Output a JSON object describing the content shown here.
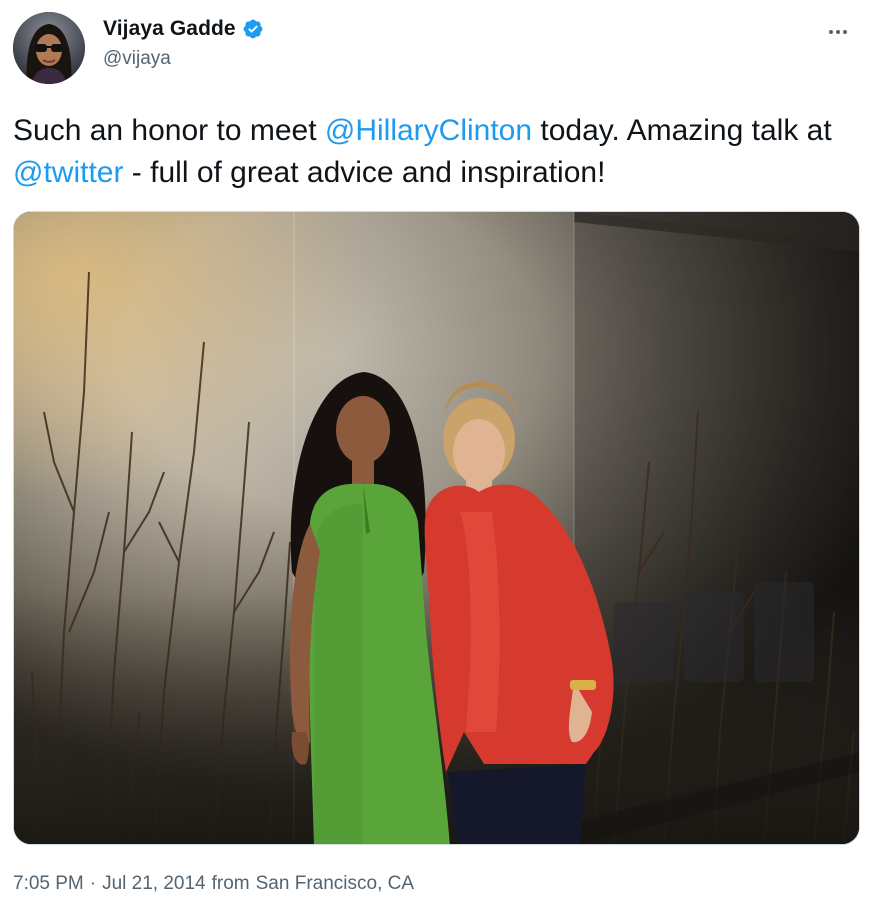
{
  "author": {
    "display_name": "Vijaya Gadde",
    "handle": "@vijaya",
    "verified": true,
    "avatar_icon": "profile-photo"
  },
  "menu": {
    "icon": "more-horizontal-icon"
  },
  "tweet": {
    "text_part_1": "Such an honor to meet ",
    "mention_1": "@HillaryClinton",
    "text_part_2": " today. Amazing talk at ",
    "mention_2": "@twitter",
    "text_part_3": " - full of great advice and inspiration!"
  },
  "media": {
    "type": "photo"
  },
  "meta": {
    "time": "7:05 PM",
    "separator": "·",
    "date": "Jul 21, 2014",
    "location_prefix": "from",
    "location": "San Francisco, CA"
  },
  "colors": {
    "link": "#1d9bf0",
    "text": "#0f1419",
    "secondary": "#536471",
    "verified": "#1d9bf0"
  }
}
